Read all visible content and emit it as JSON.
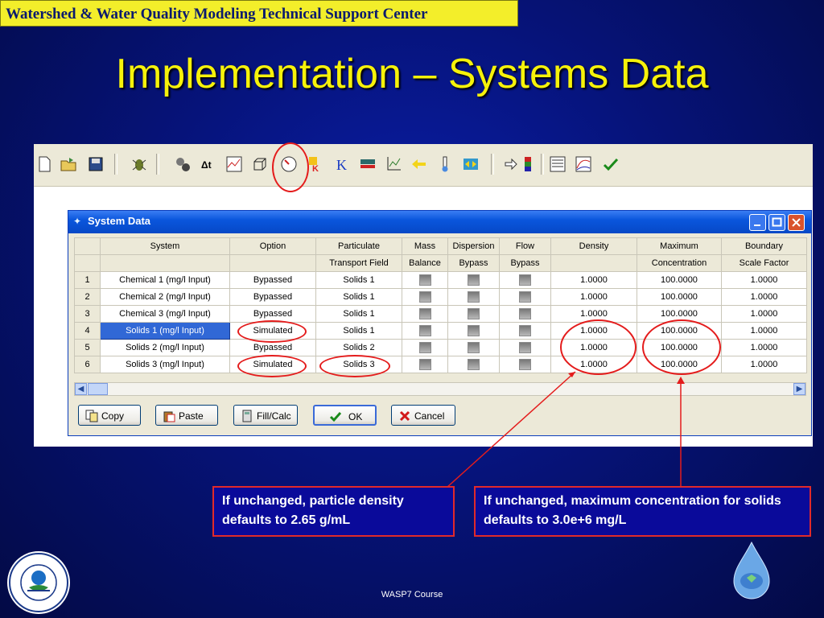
{
  "banner": {
    "text": "Watershed & Water Quality Modeling Technical Support Center"
  },
  "title": "Implementation – Systems Data",
  "toolbar": {
    "icons": [
      "new-file-icon",
      "open-folder-icon",
      "save-disk-icon",
      "bug-icon",
      "gear-puzzle-icon",
      "delta-t-icon",
      "chart-line-icon",
      "cube-icon",
      "clock-icon",
      "kinetics-icon",
      "constants-k-icon",
      "flow-pipe-icon",
      "chart-axes-icon",
      "arrows-icon",
      "thermometer-icon",
      "exchange-icon",
      "export-arrow-icon",
      "codes-icon",
      "plot-graph-icon",
      "check-icon"
    ],
    "delta_t_label": "Δt",
    "k_label": "K"
  },
  "dialog": {
    "title": "System Data",
    "columns": [
      {
        "h1": "System",
        "h2": ""
      },
      {
        "h1": "Option",
        "h2": ""
      },
      {
        "h1": "Particulate",
        "h2": "Transport Field"
      },
      {
        "h1": "Mass",
        "h2": "Balance"
      },
      {
        "h1": "Dispersion",
        "h2": "Bypass"
      },
      {
        "h1": "Flow",
        "h2": "Bypass"
      },
      {
        "h1": "Density",
        "h2": ""
      },
      {
        "h1": "Maximum",
        "h2": "Concentration"
      },
      {
        "h1": "Boundary",
        "h2": "Scale Factor"
      }
    ],
    "rows": [
      {
        "n": "1",
        "system": "Chemical 1 (mg/l Input)",
        "option": "Bypassed",
        "particulate": "Solids 1",
        "density": "1.0000",
        "max": "100.0000",
        "boundary": "1.0000"
      },
      {
        "n": "2",
        "system": "Chemical 2 (mg/l Input)",
        "option": "Bypassed",
        "particulate": "Solids 1",
        "density": "1.0000",
        "max": "100.0000",
        "boundary": "1.0000"
      },
      {
        "n": "3",
        "system": "Chemical 3 (mg/l Input)",
        "option": "Bypassed",
        "particulate": "Solids 1",
        "density": "1.0000",
        "max": "100.0000",
        "boundary": "1.0000"
      },
      {
        "n": "4",
        "system": "Solids 1 (mg/l Input)",
        "option": "Simulated",
        "particulate": "Solids 1",
        "density": "1.0000",
        "max": "100.0000",
        "boundary": "1.0000"
      },
      {
        "n": "5",
        "system": "Solids 2 (mg/l Input)",
        "option": "Bypassed",
        "particulate": "Solids 2",
        "density": "1.0000",
        "max": "100.0000",
        "boundary": "1.0000"
      },
      {
        "n": "6",
        "system": "Solids 3 (mg/l Input)",
        "option": "Simulated",
        "particulate": "Solids 3",
        "density": "1.0000",
        "max": "100.0000",
        "boundary": "1.0000"
      }
    ],
    "buttons": {
      "copy": "Copy",
      "paste": "Paste",
      "fill": "Fill/Calc",
      "ok": "OK",
      "cancel": "Cancel"
    }
  },
  "notes": {
    "density": "If unchanged, particle density defaults to 2.65 g/mL",
    "maxconc": "If unchanged, maximum concentration for solids defaults to 3.0e+6 mg/L"
  },
  "footer": "WASP7 Course",
  "colors": {
    "accent": "#f6f20a",
    "callout": "#e41c1c",
    "background": "#06137a"
  }
}
